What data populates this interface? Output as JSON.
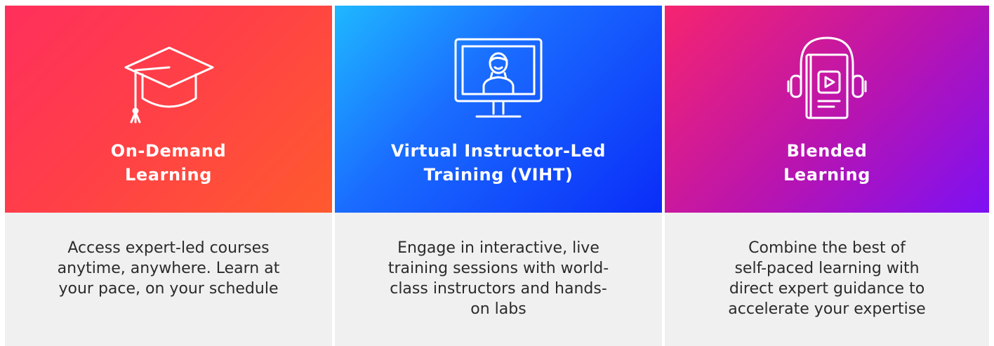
{
  "cards": [
    {
      "icon": "graduation-cap-icon",
      "gradient": [
        "#ff2f5c",
        "#ff5a2e"
      ],
      "title_lines": [
        "On-Demand",
        "Learning"
      ],
      "description_lines": [
        "Access expert-led courses",
        "anytime, anywhere. Learn at",
        "your pace, on your schedule"
      ]
    },
    {
      "icon": "monitor-instructor-icon",
      "gradient": [
        "#1fb8ff",
        "#0a2cf8"
      ],
      "title_lines": [
        "Virtual Instructor-Led",
        "Training (VIHT)"
      ],
      "description_lines": [
        "Engage in interactive, live",
        "training sessions with world-",
        "class instructors and hands-",
        "on labs"
      ]
    },
    {
      "icon": "book-headphones-icon",
      "gradient": [
        "#f6246f",
        "#7d10f4"
      ],
      "title_lines": [
        "Blended",
        "Learning"
      ],
      "description_lines": [
        "Combine the best of",
        "self-paced learning with",
        "direct expert guidance to",
        "accelerate your expertise"
      ]
    }
  ]
}
